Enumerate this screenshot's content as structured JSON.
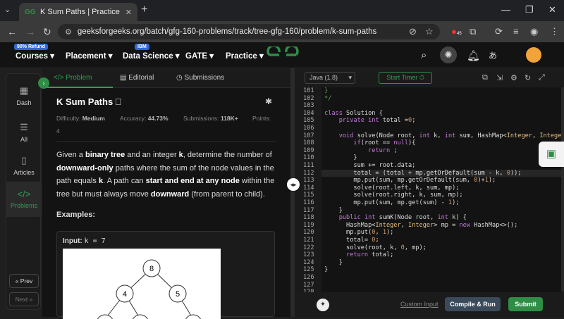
{
  "browser": {
    "tab_title": "K Sum Paths | Practice | GeeksforG",
    "tab_close": "✕",
    "url": "geeksforgeeks.org/batch/gfg-160-problems/track/tree-gfg-160/problem/k-sum-paths",
    "extension_badge": "45"
  },
  "site_nav": {
    "courses": "Courses ▾",
    "courses_badge": "90% Refund",
    "placement": "Placement ▾",
    "data_science": "Data Science ▾",
    "data_science_badge": "IBM",
    "gate": "GATE ▾",
    "practice": "Practice ▾",
    "logo": "GfG"
  },
  "rail": {
    "dash": "Dash",
    "all": "All",
    "articles": "Articles",
    "problems": "Problems",
    "prev": "« Prev",
    "next": "Next »"
  },
  "problem_tabs": {
    "problem": "Problem",
    "editorial": "Editorial",
    "submissions": "Submissions"
  },
  "problem": {
    "title": "K Sum Paths",
    "difficulty_label": "Difficulty:",
    "difficulty": "Medium",
    "accuracy_label": "Accuracy:",
    "accuracy": "44.73%",
    "submissions_label": "Submissions:",
    "submissions": "118K+",
    "points_label": "Points:",
    "points": "4",
    "desc_1": "Given a ",
    "desc_2": "binary tree",
    "desc_3": " and an integer ",
    "desc_4": "k",
    "desc_5": ", determine the number of ",
    "desc_6": "downward-only",
    "desc_7": " paths where the sum of the node values in the path equals ",
    "desc_8": "k",
    "desc_9": ". A path can ",
    "desc_10": "start and end at any node",
    "desc_11": " within the tree but must always move ",
    "desc_12": "downward",
    "desc_13": " (from parent to child).",
    "examples": "Examples:",
    "input_label": "Input:",
    "input_value": "k = 7",
    "tree_nodes": [
      "8",
      "4",
      "5"
    ]
  },
  "editor": {
    "language": "Java (1.8)",
    "timer": "Start Timer ⏱",
    "custom_input": "Custom Input",
    "compile_run": "Compile & Run",
    "submit": "Submit",
    "line_numbers": [
      "101",
      "102",
      "103",
      "104",
      "105",
      "106",
      "107",
      "108",
      "109",
      "110",
      "111",
      "112",
      "113",
      "114",
      "115",
      "116",
      "117",
      "118",
      "119",
      "120",
      "121",
      "122",
      "123",
      "124",
      "125",
      "126",
      "127",
      "128"
    ]
  },
  "colors": {
    "accent": "#2f8d46",
    "accent_text": "#2f9e56"
  }
}
